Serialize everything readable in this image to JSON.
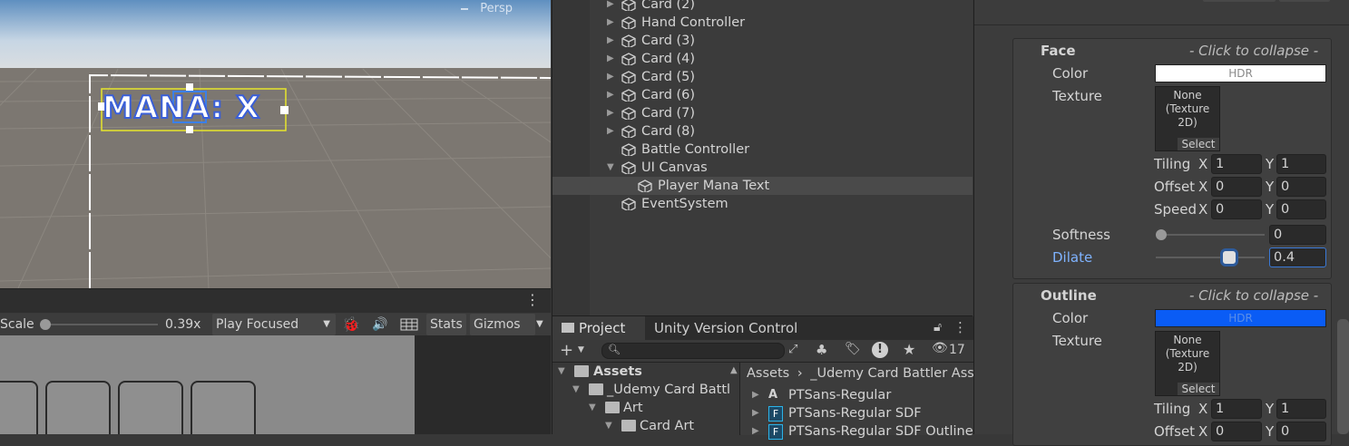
{
  "scene": {
    "text_object": "MANA: X",
    "back_label": "Persp"
  },
  "game_toolbar": {
    "scale_label": "Scale",
    "scale_value": "0.39x",
    "play_mode": "Play Focused",
    "stats_label": "Stats",
    "gizmos_label": "Gizmos"
  },
  "hierarchy": {
    "items": [
      {
        "label": "Card (2)",
        "expandable": true
      },
      {
        "label": "Hand Controller",
        "expandable": true
      },
      {
        "label": "Card (3)",
        "expandable": true
      },
      {
        "label": "Card (4)",
        "expandable": true
      },
      {
        "label": "Card (5)",
        "expandable": true
      },
      {
        "label": "Card (6)",
        "expandable": true
      },
      {
        "label": "Card (7)",
        "expandable": true
      },
      {
        "label": "Card (8)",
        "expandable": true
      },
      {
        "label": "Battle Controller",
        "expandable": false
      },
      {
        "label": "UI Canvas",
        "expandable": true,
        "expanded": true
      },
      {
        "label": "Player Mana Text",
        "expandable": false,
        "selected": true
      },
      {
        "label": "EventSystem",
        "expandable": false
      }
    ]
  },
  "project": {
    "tabs": {
      "project": "Project",
      "version_control": "Unity Version Control"
    },
    "hidden_count": "17",
    "tree": {
      "assets": "Assets",
      "udemy": "_Udemy Card Battl",
      "art": "Art",
      "card_art": "Card Art"
    },
    "breadcrumb": {
      "root": "Assets",
      "sub": "_Udemy Card Battler Ass"
    },
    "files": [
      "PTSans-Regular",
      "PTSans-Regular SDF",
      "PTSans-Regular SDF Outline"
    ]
  },
  "inspector": {
    "face": {
      "title": "Face",
      "collapse": "- Click to collapse -",
      "color_label": "Color",
      "color_value": "#ffffff",
      "hdr": "HDR",
      "texture_label": "Texture",
      "texture_none": "None (Texture 2D)",
      "select": "Select",
      "tiling_label": "Tiling",
      "tiling_x": "1",
      "tiling_y": "1",
      "offset_label": "Offset",
      "offset_x": "0",
      "offset_y": "0",
      "speed_label": "Speed",
      "speed_x": "0",
      "speed_y": "0",
      "softness_label": "Softness",
      "softness_value": "0",
      "dilate_label": "Dilate",
      "dilate_value": "0.4"
    },
    "outline": {
      "title": "Outline",
      "collapse": "- Click to collapse -",
      "color_label": "Color",
      "color_value": "#0a5cf5",
      "hdr": "HDR",
      "texture_label": "Texture",
      "texture_none": "None (Texture 2D)",
      "select": "Select",
      "tiling_label": "Tiling",
      "tiling_x": "1",
      "tiling_y": "1",
      "offset_label": "Offset",
      "offset_x": "0",
      "offset_y": "0"
    },
    "axis_x": "X",
    "axis_y": "Y"
  },
  "colors": {
    "accent": "#7fb3ff",
    "selection": "#4a4a4a",
    "outline_blue": "#0a5cf5"
  }
}
